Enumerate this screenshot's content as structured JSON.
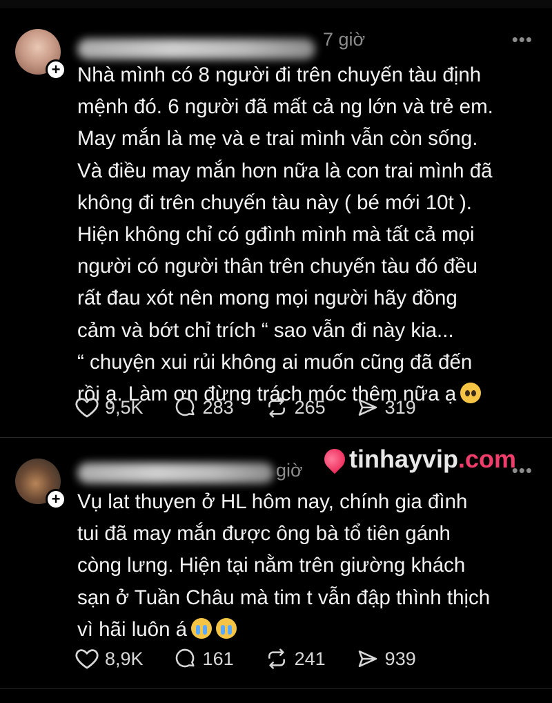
{
  "post1": {
    "time": "7 giờ",
    "more": "•••",
    "follow": "+",
    "content": "Nhà mình có 8 người đi trên chuyến tàu định\nmệnh đó. 6 người đã mất cả ng lớn và trẻ em.\nMay mắn là mẹ và e trai mình vẫn còn sống.\nVà điều may mắn hơn nữa là con trai mình đã\nkhông đi trên chuyến tàu này ( bé mới 10t ).\nHiện không chỉ có gđình mình mà tất cả mọi\nngười có người thân trên chuyến tàu đó đều\nrất đau xót nên mong mọi người hãy đồng\ncảm và bớt chỉ trích “ sao vẫn đi này kia...\n“ chuyện xui rủi không ai muốn cũng đã đến\nrồi ạ. Làm ơn đừng trách móc thêm nữa ạ",
    "emoji": "pleading-face-emoji",
    "likes": "9,5K",
    "comments": "283",
    "reposts": "265",
    "shares": "319"
  },
  "post2": {
    "time": "giờ",
    "more": "•••",
    "follow": "+",
    "content": "Vụ lat thuyen ở HL hôm nay, chính gia đình\ntui đã may mắn được ông bà tổ tiên gánh\ncòng lưng. Hiện tại nằm trên giường khách\nsạn ở Tuần Châu mà tim t vẫn đập thình thịch\nvì hãi luôn á",
    "emoji": "loudly-crying-face-emoji",
    "likes": "8,9K",
    "comments": "161",
    "reposts": "241",
    "shares": "939"
  },
  "watermark": {
    "name": "tinhayvip",
    "domain": ".com"
  },
  "colors": {
    "background": "#000000",
    "text": "#f3f3f3",
    "muted": "#8c8c8c",
    "accent": "#f03d6b"
  }
}
